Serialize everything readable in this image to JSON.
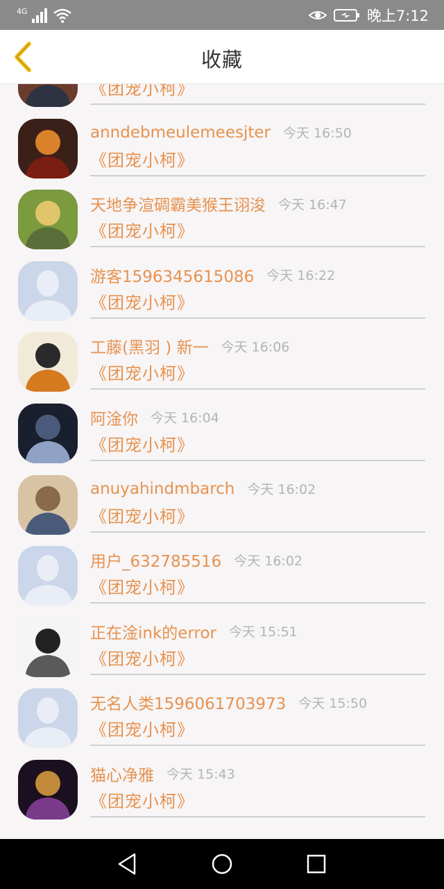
{
  "status_bar": {
    "network": "4G",
    "time": "晚上7:12"
  },
  "header": {
    "title": "收藏"
  },
  "colors": {
    "accent": "#e7924f",
    "back_icon": "#f1c21b",
    "time_text": "#b4b4b4"
  },
  "items": [
    {
      "name": "",
      "time": "",
      "book": "《团宠小柯》",
      "avatar": "artwork-1"
    },
    {
      "name": "anndebmeulemeesjter",
      "time": "今天 16:50",
      "book": "《团宠小柯》",
      "avatar": "artwork-2"
    },
    {
      "name": "天地争渲碉霸美猴王诩浚",
      "time": "今天 16:47",
      "book": "《团宠小柯》",
      "avatar": "artwork-3"
    },
    {
      "name": "游客1596345615086",
      "time": "今天 16:22",
      "book": "《团宠小柯》",
      "avatar": "default"
    },
    {
      "name": "工藤(黑羽 ) 新一",
      "time": "今天 16:06",
      "book": "《团宠小柯》",
      "avatar": "artwork-4"
    },
    {
      "name": "阿淦你",
      "time": "今天 16:04",
      "book": "《团宠小柯》",
      "avatar": "artwork-5"
    },
    {
      "name": "anuyahindmbarch",
      "time": "今天 16:02",
      "book": "《团宠小柯》",
      "avatar": "photo-child"
    },
    {
      "name": "用户_632785516",
      "time": "今天 16:02",
      "book": "《团宠小柯》",
      "avatar": "default"
    },
    {
      "name": "正在淦ink的error",
      "time": "今天 15:51",
      "book": "《团宠小柯》",
      "avatar": "artwork-6"
    },
    {
      "name": "无名人类1596061703973",
      "time": "今天 15:50",
      "book": "《团宠小柯》",
      "avatar": "default"
    },
    {
      "name": "猫心净雅",
      "time": "今天 15:43",
      "book": "《团宠小柯》",
      "avatar": "artwork-7"
    }
  ]
}
